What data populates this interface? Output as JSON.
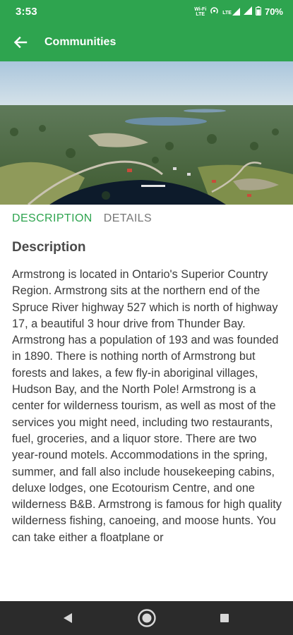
{
  "status_bar": {
    "time": "3:53",
    "battery": "70%",
    "wifi_label_top": "Wi-Fi",
    "wifi_label_bottom": "LTE",
    "lte_label": "LTE",
    "icons": [
      "wifi-calling-icon",
      "hotspot-icon",
      "lte-signal-icon",
      "signal-icon",
      "battery-icon"
    ]
  },
  "app_bar": {
    "title": "Communities",
    "back_icon": "arrow-back-icon"
  },
  "tabs": [
    {
      "label": "DESCRIPTION",
      "active": true
    },
    {
      "label": "DETAILS",
      "active": false
    }
  ],
  "content": {
    "section_title": "Description",
    "body": "Armstrong is located in Ontario's Superior Country Region. Armstrong sits at the northern end of the Spruce River highway 527 which is north of highway 17, a beautiful 3 hour drive from Thunder Bay. Armstrong has a population of 193 and was founded in 1890. There is nothing north of Armstrong but forests and lakes, a few fly-in aboriginal villages, Hudson Bay, and the North Pole! Armstrong is a center for wilderness tourism, as well as most of the services you might need, including two restaurants, fuel, groceries, and a liquor store. There are two year-round motels. Accommodations in the spring, summer, and fall also include housekeeping cabins, deluxe lodges, one Ecotourism Centre, and one wilderness B&B. Armstrong is famous for high quality wilderness fishing, canoeing, and moose hunts. You can take either a floatplane or"
  },
  "nav_bar": {
    "buttons": [
      "back-triangle-icon",
      "home-circle-icon",
      "recents-square-icon"
    ]
  },
  "colors": {
    "accent": "#2ea44f",
    "nav_background": "#2b2b2b",
    "text": "#3c3c3c"
  }
}
